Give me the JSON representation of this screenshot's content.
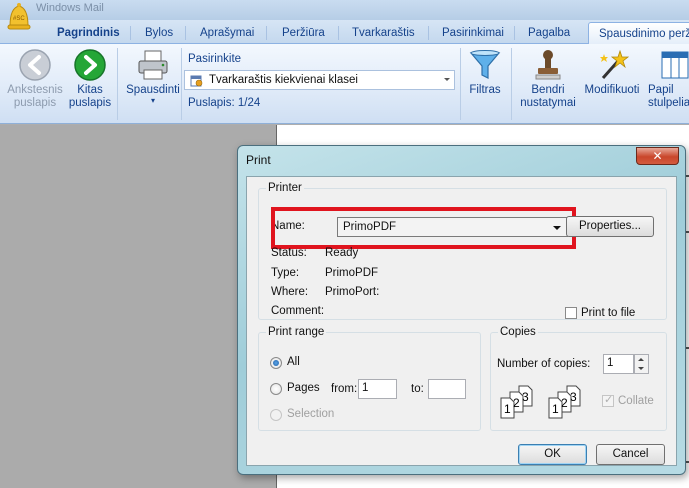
{
  "window": {
    "app_title": "Windows Mail"
  },
  "tabs": [
    {
      "label": "Pagrindinis",
      "active": false,
      "bold": true
    },
    {
      "label": "Bylos",
      "active": false,
      "bold": false
    },
    {
      "label": "Aprašymai",
      "active": false,
      "bold": false
    },
    {
      "label": "Peržiūra",
      "active": false,
      "bold": false
    },
    {
      "label": "Tvarkaraštis",
      "active": false,
      "bold": false
    },
    {
      "label": "Pasirinkimai",
      "active": false,
      "bold": false
    },
    {
      "label": "Pagalba",
      "active": false,
      "bold": false
    },
    {
      "label": "Spausdinimo perž",
      "active": true,
      "bold": false
    }
  ],
  "ribbon": {
    "prev_page": "Ankstesnis puslapis",
    "next_page": "Kitas puslapis",
    "print": "Spausdinti",
    "select_label": "Pasirinkite",
    "select_value": "Tvarkaraštis kiekvienai klasei",
    "page_info": "Puslapis: 1/24",
    "filter": "Filtras",
    "common_settings": "Bendri nustatymai",
    "modify": "Modifikuoti",
    "more": "Papil stulpelia"
  },
  "dialog": {
    "title": "Print",
    "close_symbol": "✕",
    "printer_group": "Printer",
    "name_label": "Name:",
    "printer_name": "PrimoPDF",
    "properties_button": "Properties...",
    "status_label": "Status:",
    "status_value": "Ready",
    "type_label": "Type:",
    "type_value": "PrimoPDF",
    "where_label": "Where:",
    "where_value": "PrimoPort:",
    "comment_label": "Comment:",
    "print_to_file": "Print to file",
    "range_group": "Print range",
    "range_all": "All",
    "range_pages": "Pages",
    "from_label": "from:",
    "from_value": "1",
    "to_label": "to:",
    "to_value": "",
    "range_selection": "Selection",
    "copies_group": "Copies",
    "copies_label": "Number of copies:",
    "copies_value": "1",
    "collate": "Collate",
    "ok_button": "OK",
    "cancel_button": "Cancel",
    "page_digits": [
      "1",
      "2",
      "3"
    ]
  },
  "colors": {
    "tab_text": "#15428b",
    "highlight_box": "#e0141e"
  }
}
